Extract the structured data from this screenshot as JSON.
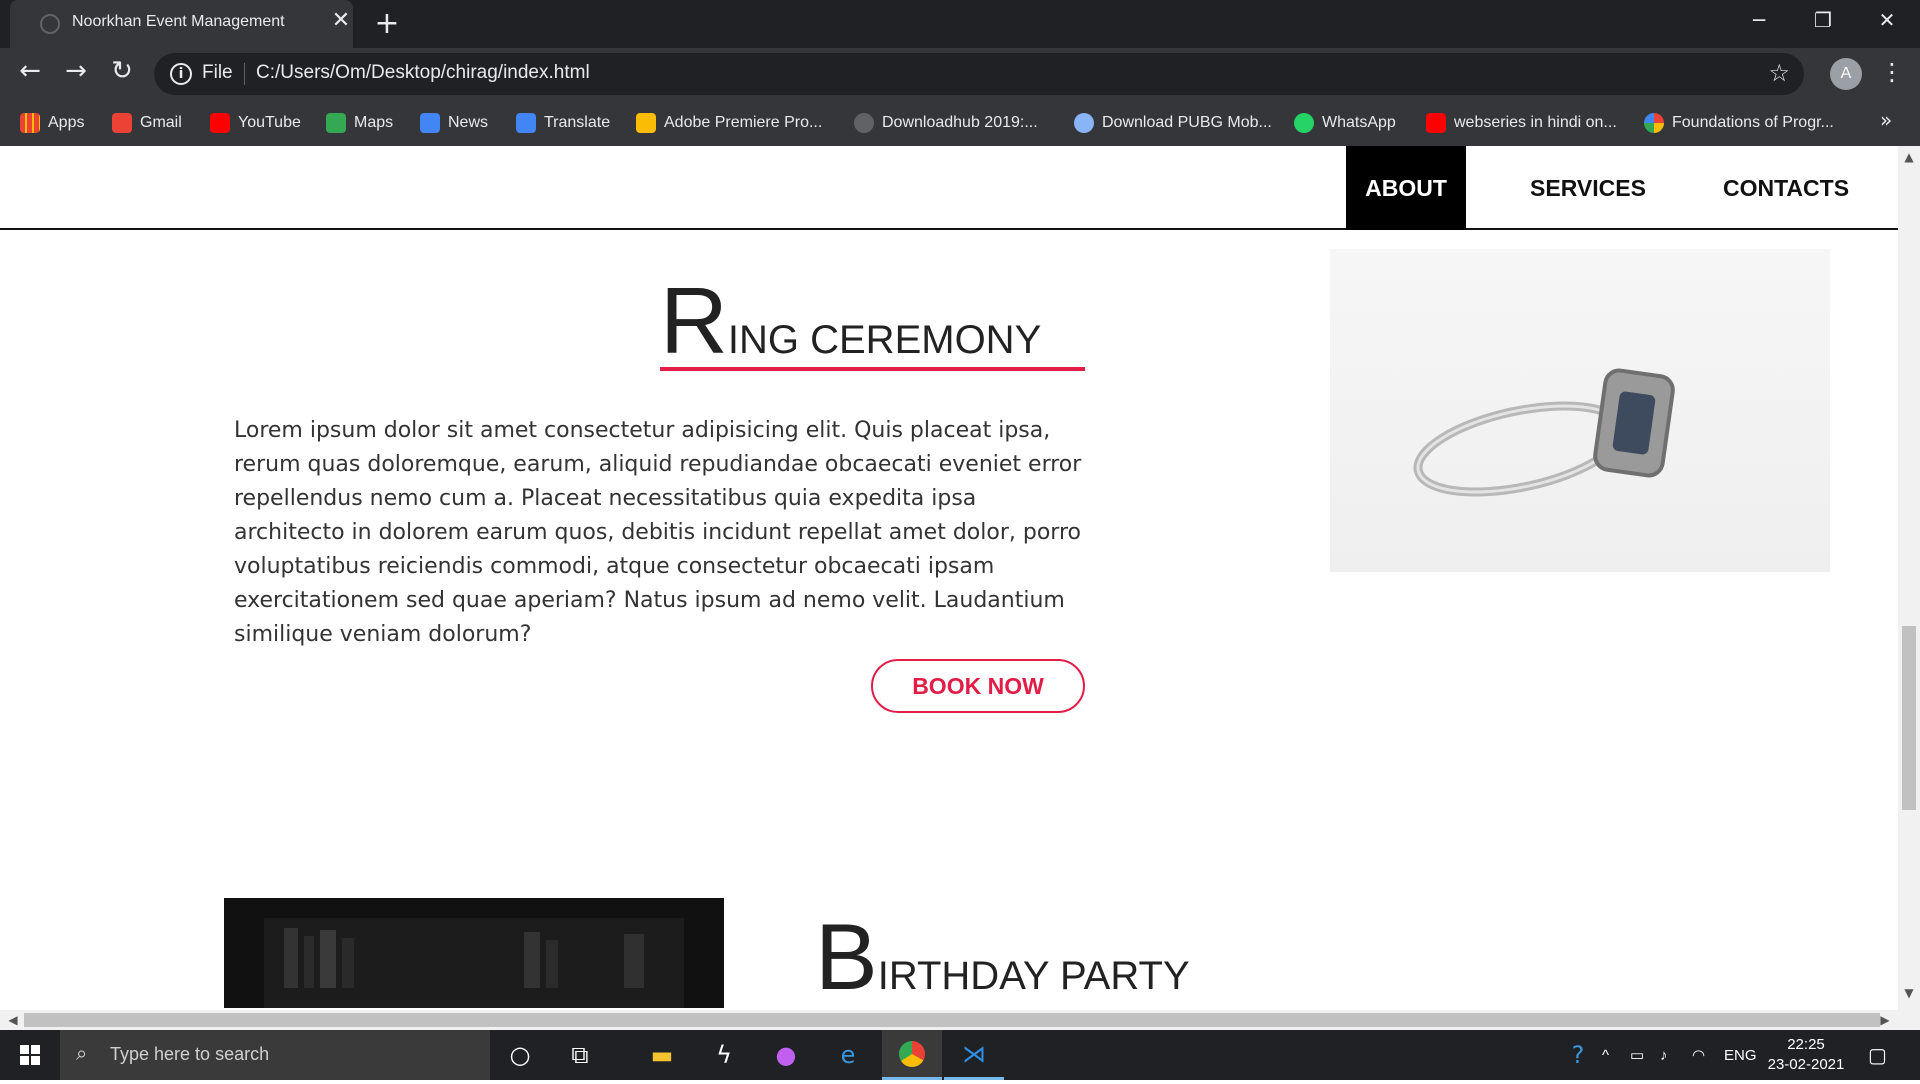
{
  "browser": {
    "tab_title": "Noorkhan Event Management",
    "address_scheme": "File",
    "url": "C:/Users/Om/Desktop/chirag/index.html",
    "profile_initial": "A",
    "bookmarks": [
      {
        "label": "Apps",
        "icon": "apps-grid-icon",
        "color": "#ea4335"
      },
      {
        "label": "Gmail",
        "icon": "gmail-icon",
        "color": "#ea4335"
      },
      {
        "label": "YouTube",
        "icon": "youtube-icon",
        "color": "#ff0000"
      },
      {
        "label": "Maps",
        "icon": "maps-icon",
        "color": "#34a853"
      },
      {
        "label": "News",
        "icon": "news-icon",
        "color": "#4285f4"
      },
      {
        "label": "Translate",
        "icon": "translate-icon",
        "color": "#4285f4"
      },
      {
        "label": "Adobe Premiere Pro...",
        "icon": "google-g-icon",
        "color": "#fbbc05"
      },
      {
        "label": "Downloadhub 2019:...",
        "icon": "downloadhub-icon",
        "color": "#9aa0a6"
      },
      {
        "label": "Download PUBG Mob...",
        "icon": "pubg-icon",
        "color": "#8ab4f8"
      },
      {
        "label": "WhatsApp",
        "icon": "whatsapp-icon",
        "color": "#25d366"
      },
      {
        "label": "webseries in hindi on...",
        "icon": "youtube-icon",
        "color": "#ff0000"
      },
      {
        "label": "Foundations of Progr...",
        "icon": "google-icon",
        "color": "#4285f4"
      }
    ]
  },
  "site": {
    "nav": {
      "about": "ABOUT",
      "services": "SERVICES",
      "contacts": "CONTACTS"
    },
    "ring": {
      "title_initial": "R",
      "title_rest": "ING CEREMONY",
      "body": "Lorem ipsum dolor sit amet consectetur adipisicing elit. Quis placeat ipsa, rerum quas doloremque, earum, aliquid repudiandae obcaecati eveniet error repellendus nemo cum a. Placeat necessitatibus quia expedita ipsa architecto in dolorem earum quos, debitis incidunt repellat amet dolor, porro voluptatibus reiciendis commodi, atque consectetur obcaecati ipsam exercitationem sed quae aperiam? Natus ipsum ad nemo velit. Laudantium similique veniam dolorum?",
      "button": "BOOK NOW"
    },
    "birthday": {
      "title_initial": "B",
      "title_rest": "IRTHDAY PARTY"
    },
    "accent_color": "#e11d48"
  },
  "taskbar": {
    "search_placeholder": "Type here to search",
    "language": "ENG",
    "time": "22:25",
    "date": "23-02-2021"
  }
}
